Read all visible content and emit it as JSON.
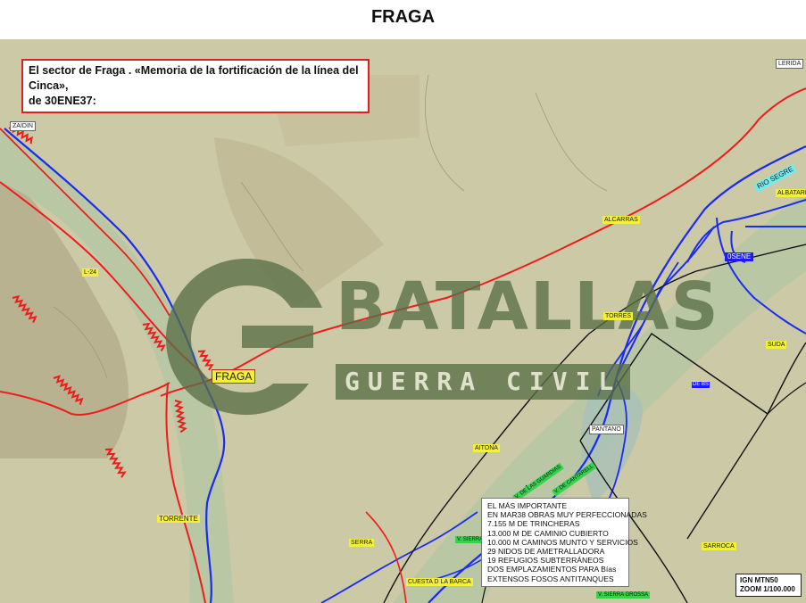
{
  "title": "FRAGA",
  "callout": {
    "line1": "El sector de Fraga . «Memoria de la fortificación de la línea del Cinca»,",
    "line2": "de 30ENE37:"
  },
  "places": {
    "zaidin": "ZAIDIN",
    "lerida": "LERIDA",
    "fraga": "FRAGA",
    "torrente": "TORRENTE",
    "l24": "L-24",
    "rio_segre": "RIO SEGRE",
    "blue_label": "0SENE",
    "blue_label_small": "DE BS",
    "alcarras": "ALCARRAS",
    "albatarrec": "ALBATARREC",
    "torres": "TORRES",
    "sudanell": "SUDA",
    "sarroca": "SARROCA",
    "aitona": "AITONA",
    "pantano": "PANTANO",
    "serra": "SERRA",
    "cuesta": "CUESTA D LA BARCA",
    "v_sierra_grossa": "V. SIERRA GROSSA",
    "v_sierra": "V. SIERRA",
    "v_guardias": "V. DE LAS GUARDIAS",
    "v_cantarell": "V. DE CANTARELL"
  },
  "watermark": {
    "line1": "BATALLAS",
    "line2": "GUERRA CIVIL"
  },
  "summary": {
    "lines": [
      "EL MÁS IMPORTANTE",
      "EN MAR38 OBRAS MUY PERFECCIONADAS",
      "7.155 M DE TRINCHERAS",
      "13.000 M DE CAMINIO CUBIERTO",
      "10.000 M CAMINOS MUNTO Y SERVICIOS",
      "29 NIDOS DE AMETRALLADORA",
      "19 REFUGIOS SUBTERRÁNEOS",
      "DOS EMPLAZAMIENTOS PARA Bías",
      "EXTENSOS FOSOS ANTITANQUES"
    ]
  },
  "scale": {
    "line1": "IGN MTN50",
    "line2": "ZOOM 1/100.000"
  },
  "colors": {
    "terrain": "#c9c7a3",
    "river_plain": "#b8c6a4",
    "front_line": "#ee1c1c",
    "river": "#1a2cf0",
    "black_lines": "#111111",
    "watermark": "#587046"
  }
}
